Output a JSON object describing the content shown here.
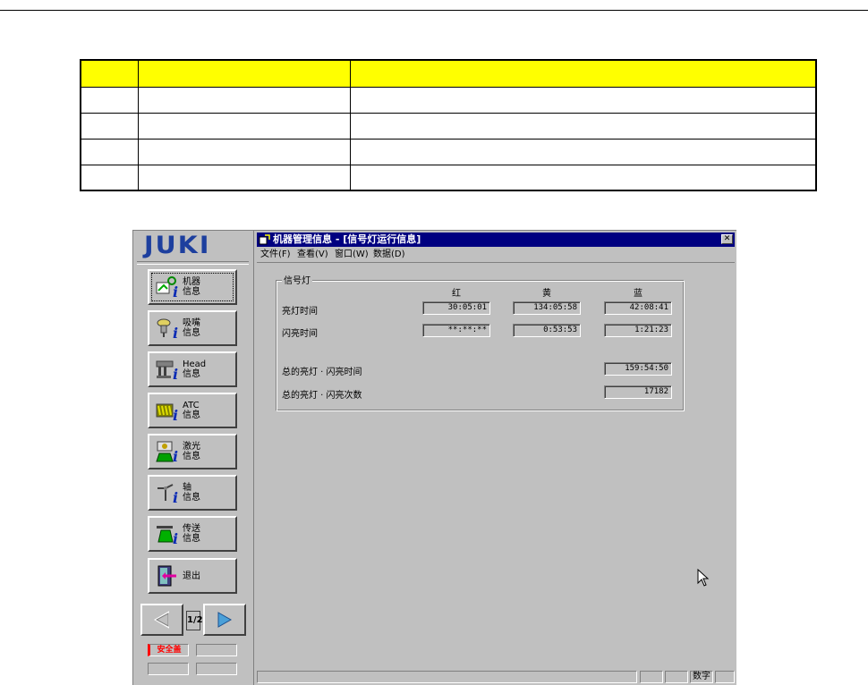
{
  "doc_table": {
    "rows": [
      [
        "",
        "",
        ""
      ],
      [
        "",
        "",
        ""
      ],
      [
        "",
        "",
        ""
      ],
      [
        "",
        "",
        ""
      ],
      [
        "",
        "",
        ""
      ]
    ]
  },
  "sidebar": {
    "logo": "JUKI",
    "buttons": [
      {
        "label": "机器\n信息",
        "icon": "machine-info-icon",
        "active": true
      },
      {
        "label": "吸嘴\n信息",
        "icon": "nozzle-info-icon"
      },
      {
        "label": "Head\n信息",
        "icon": "head-info-icon"
      },
      {
        "label": "ATC\n信息",
        "icon": "atc-info-icon"
      },
      {
        "label": "激光\n信息",
        "icon": "laser-info-icon"
      },
      {
        "label": "轴\n信息",
        "icon": "axis-info-icon"
      },
      {
        "label": "传送\n信息",
        "icon": "conveyor-info-icon"
      },
      {
        "label": "退出",
        "icon": "exit-icon"
      }
    ],
    "page_indicator": "1/2",
    "safety_label": "安全盖"
  },
  "window": {
    "title": "机器管理信息 - [信号灯运行信息]",
    "menu": [
      "文件(F)",
      "查看(V)",
      "窗口(W)",
      "数据(D)"
    ],
    "group_title": "信号灯",
    "columns": [
      "红",
      "黄",
      "蓝"
    ],
    "rows": [
      {
        "label": "亮灯时间",
        "values": [
          "30:05:01",
          "134:05:58",
          "42:08:41"
        ]
      },
      {
        "label": "闪亮时间",
        "values": [
          "**:**:**",
          "0:53:53",
          "1:21:23"
        ]
      }
    ],
    "total_time_label": "总的亮灯 · 闪亮时间",
    "total_time_value": "159:54:50",
    "total_count_label": "总的亮灯 · 闪亮次数",
    "total_count_value": "17182",
    "status_mode": "数字"
  },
  "colors": {
    "titlebar": "#000080",
    "logo": "#1d3f9e",
    "table_header": "#ffff00",
    "safety": "#ff0000"
  }
}
